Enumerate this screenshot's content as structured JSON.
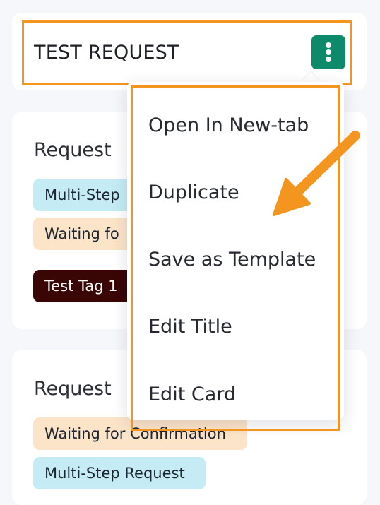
{
  "top_card": {
    "title": "TEST REQUEST"
  },
  "middle_card": {
    "title": "Request",
    "tags": [
      "Multi-Step",
      "Waiting fo",
      "Test Tag 1"
    ]
  },
  "bottom_card": {
    "title": "Request",
    "tags": [
      "Waiting for Confirmation",
      "Multi-Step Request"
    ]
  },
  "context_menu": {
    "items": [
      "Open In New-tab",
      "Duplicate",
      "Save as Template",
      "Edit Title",
      "Edit Card"
    ]
  },
  "icons": {
    "more_button": "more-vertical-icon",
    "annotation": "arrow-pointer-icon"
  },
  "colors": {
    "highlight": "#f4951f",
    "more_button_bg": "#0c8a6a",
    "tag_blue": "#c5ecf5",
    "tag_peach": "#fce4c8",
    "tag_dark": "#3a0505"
  }
}
